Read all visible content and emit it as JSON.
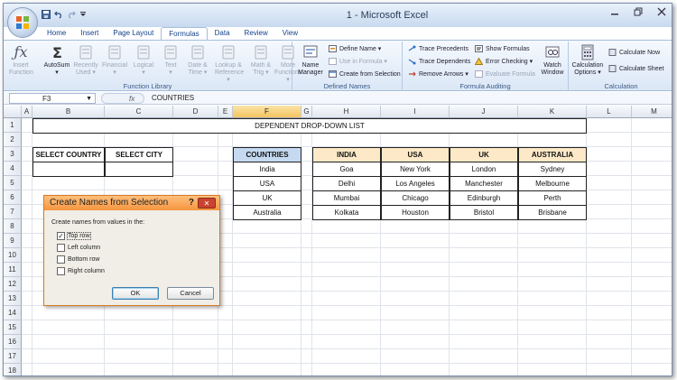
{
  "title_bar": {
    "title": "1 - Microsoft Excel",
    "quick_access": [
      "save-icon",
      "undo-icon",
      "redo-icon",
      "customize-icon"
    ]
  },
  "tabs": [
    "Home",
    "Insert",
    "Page Layout",
    "Formulas",
    "Data",
    "Review",
    "View"
  ],
  "active_tab": "Formulas",
  "ribbon": {
    "function_library": {
      "label": "Function Library",
      "insert_function": "Insert\nFunction",
      "buttons": [
        {
          "label": "AutoSum",
          "sub": "▾",
          "enabled": true
        },
        {
          "label": "Recently",
          "sub": "Used ▾",
          "enabled": false
        },
        {
          "label": "Financial",
          "sub": "▾",
          "enabled": false
        },
        {
          "label": "Logical",
          "sub": "▾",
          "enabled": false
        },
        {
          "label": "Text",
          "sub": "▾",
          "enabled": false
        },
        {
          "label": "Date &",
          "sub": "Time ▾",
          "enabled": false
        },
        {
          "label": "Lookup &",
          "sub": "Reference ▾",
          "enabled": false
        },
        {
          "label": "Math &",
          "sub": "Trig ▾",
          "enabled": false
        },
        {
          "label": "More",
          "sub": "Functions ▾",
          "enabled": false
        }
      ]
    },
    "defined_names": {
      "label": "Defined Names",
      "name_manager": "Name\nManager",
      "define_name": "Define Name ▾",
      "use_in_formula": "Use in Formula ▾",
      "create_from_selection": "Create from Selection"
    },
    "formula_auditing": {
      "label": "Formula Auditing",
      "trace_precedents": "Trace Precedents",
      "trace_dependents": "Trace Dependents",
      "remove_arrows": "Remove Arrows ▾",
      "show_formulas": "Show Formulas",
      "error_checking": "Error Checking ▾",
      "evaluate_formula": "Evaluate Formula",
      "watch_window": "Watch\nWindow"
    },
    "calculation": {
      "label": "Calculation",
      "calc_options": "Calculation\nOptions ▾",
      "calculate_now": "Calculate Now",
      "calculate_sheet": "Calculate Sheet"
    }
  },
  "formula_bar": {
    "name_box": "F3",
    "fx": "fx",
    "value": "COUNTRIES"
  },
  "sheet": {
    "columns": [
      "A",
      "B",
      "C",
      "D",
      "E",
      "F",
      "G",
      "H",
      "I",
      "J",
      "K",
      "L",
      "M"
    ],
    "rows": [
      "1",
      "2",
      "3",
      "4",
      "5",
      "6",
      "7",
      "8",
      "9",
      "10",
      "11",
      "12",
      "13",
      "14",
      "15",
      "16",
      "17",
      "18",
      "19"
    ],
    "selected_column": "F",
    "banner": "DEPENDENT DROP-DOWN LIST",
    "select_country": "SELECT COUNTRY",
    "select_city": "SELECT CITY",
    "countries_header": "COUNTRIES",
    "countries": [
      "India",
      "USA",
      "UK",
      "Australia"
    ],
    "city_headers": [
      "INDIA",
      "USA",
      "UK",
      "AUSTRALIA"
    ],
    "city_rows": [
      [
        "Goa",
        "New York",
        "London",
        "Sydney"
      ],
      [
        "Delhi",
        "Los Angeles",
        "Manchester",
        "Melbourne"
      ],
      [
        "Mumbai",
        "Chicago",
        "Edinburgh",
        "Perth"
      ],
      [
        "Kolkata",
        "Houston",
        "Bristol",
        "Brisbane"
      ]
    ]
  },
  "dialog": {
    "title": "Create Names from Selection",
    "help": "?",
    "close": "✕",
    "prompt": "Create names from values in the:",
    "options": [
      {
        "label": "Top row",
        "checked": true
      },
      {
        "label": "Left column",
        "checked": false
      },
      {
        "label": "Bottom row",
        "checked": false
      },
      {
        "label": "Right column",
        "checked": false
      }
    ],
    "ok": "OK",
    "cancel": "Cancel"
  }
}
